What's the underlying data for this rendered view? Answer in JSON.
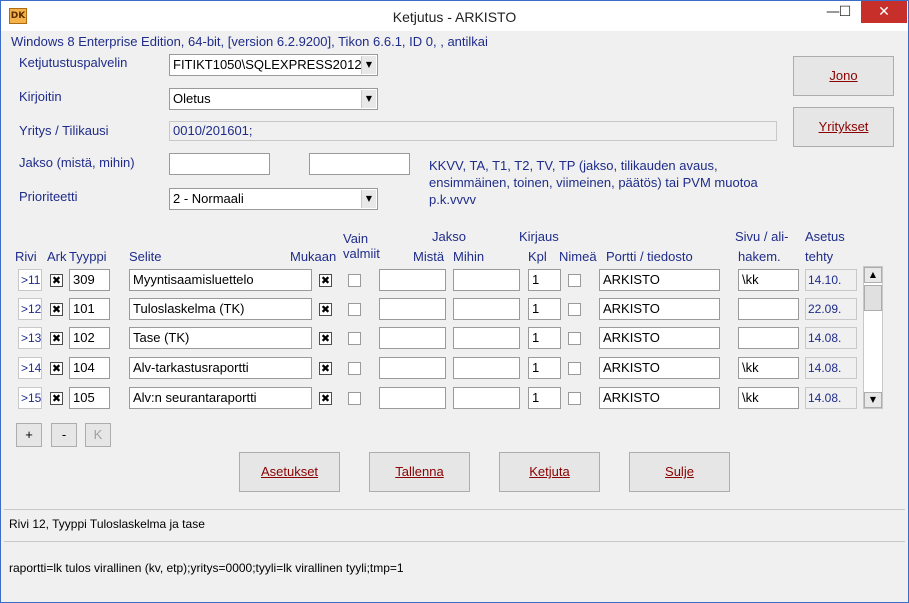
{
  "window": {
    "title": "Ketjutus - ARKISTO",
    "app_icon_text": "DK",
    "minimize": "—",
    "maximize": "☐",
    "close": "✕"
  },
  "system_info": "Windows 8 Enterprise Edition, 64-bit, [version 6.2.9200], Tikon 6.6.1, ID 0, , antilkai",
  "form": {
    "server_label": "Ketjutustuspalvelin",
    "server_value": "FITIKT1050\\SQLEXPRESS2012",
    "printer_label": "Kirjoitin",
    "printer_value": "Oletus",
    "company_label": "Yritys / Tilikausi",
    "company_value": "0010/201601;",
    "period_label": "Jakso (mistä, mihin)",
    "period_from": "",
    "period_to": "",
    "period_help": "KKVV, TA, T1, T2, TV, TP (jakso, tilikauden avaus, ensimmäinen, toinen, viimeinen, päätös)  tai PVM muotoa p.k.vvvv",
    "priority_label": "Prioriteetti",
    "priority_value": "2 - Normaali"
  },
  "side_buttons": {
    "jono": "Jono",
    "yritykset": "Yritykset"
  },
  "table": {
    "headers": {
      "rivi": "Rivi",
      "ark": "Ark",
      "tyyppi": "Tyyppi",
      "selite": "Selite",
      "mukaan": "Mukaan",
      "vain1": "Vain",
      "vain2": "valmiit",
      "jakso": "Jakso",
      "mista": "Mistä",
      "mihin": "Mihin",
      "kirjaus": "Kirjaus",
      "kpl": "Kpl",
      "nimea": "Nimeä",
      "portti": "Portti / tiedosto",
      "sivu1": "Sivu / ali-",
      "sivu2": "hakem.",
      "asetus1": "Asetus",
      "asetus2": "tehty"
    },
    "rows": [
      {
        "rivi": ">11",
        "ark": "✖",
        "tyyppi": "309",
        "selite": "Myyntisaamisluettelo",
        "mukaan": "✖",
        "vain": "",
        "mista": "",
        "mihin": "",
        "kpl": "1",
        "nimea": "",
        "portti": "ARKISTO",
        "sivu": "\\kk",
        "asetus": "14.10."
      },
      {
        "rivi": ">12",
        "ark": "✖",
        "tyyppi": "101",
        "selite": "Tuloslaskelma (TK)",
        "mukaan": "✖",
        "vain": "",
        "mista": "",
        "mihin": "",
        "kpl": "1",
        "nimea": "",
        "portti": "ARKISTO",
        "sivu": "",
        "asetus": "22.09."
      },
      {
        "rivi": ">13",
        "ark": "✖",
        "tyyppi": "102",
        "selite": "Tase (TK)",
        "mukaan": "✖",
        "vain": "",
        "mista": "",
        "mihin": "",
        "kpl": "1",
        "nimea": "",
        "portti": "ARKISTO",
        "sivu": "",
        "asetus": "14.08."
      },
      {
        "rivi": ">14",
        "ark": "✖",
        "tyyppi": "104",
        "selite": "Alv-tarkastusraportti",
        "mukaan": "✖",
        "vain": "",
        "mista": "",
        "mihin": "",
        "kpl": "1",
        "nimea": "",
        "portti": "ARKISTO",
        "sivu": "\\kk",
        "asetus": "14.08."
      },
      {
        "rivi": ">15",
        "ark": "✖",
        "tyyppi": "105",
        "selite": "Alv:n seurantaraportti",
        "mukaan": "✖",
        "vain": "",
        "mista": "",
        "mihin": "",
        "kpl": "1",
        "nimea": "",
        "portti": "ARKISTO",
        "sivu": "\\kk",
        "asetus": "14.08."
      }
    ]
  },
  "row_buttons": {
    "add": "+",
    "remove": "-",
    "k": "K"
  },
  "actions": {
    "asetukset": "Asetukset",
    "tallenna": "Tallenna",
    "ketjuta": "Ketjuta",
    "sulje": "Sulje"
  },
  "status": {
    "line1": "Rivi 12, Tyyppi Tuloslaskelma ja tase",
    "line2": "raportti=lk tulos virallinen (kv, etp);yritys=0000;tyyli=lk virallinen tyyli;tmp=1"
  }
}
